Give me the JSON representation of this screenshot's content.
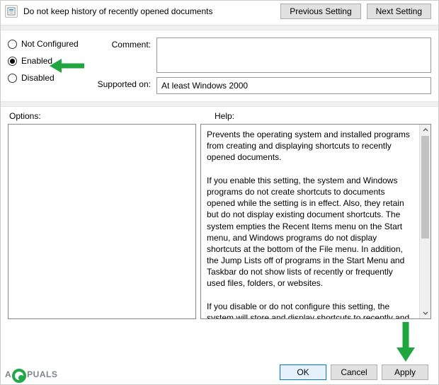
{
  "header": {
    "title": "Do not keep history of recently opened documents",
    "prev": "Previous Setting",
    "next": "Next Setting",
    "icon": "policy-icon"
  },
  "radios": {
    "not_configured": "Not Configured",
    "enabled": "Enabled",
    "disabled": "Disabled",
    "selected": "enabled"
  },
  "fields": {
    "comment_label": "Comment:",
    "comment_value": "",
    "supported_label": "Supported on:",
    "supported_value": "At least Windows 2000"
  },
  "sections": {
    "options": "Options:",
    "help": "Help:"
  },
  "help_text": "Prevents the operating system and installed programs from creating and displaying shortcuts to recently opened documents.\n\nIf you enable this setting, the system and Windows programs do not create shortcuts to documents opened while the setting is in effect. Also, they retain but do not display existing document shortcuts. The system empties the Recent Items menu on the Start menu, and Windows programs do not display shortcuts at the bottom of the File menu. In addition, the Jump Lists off of programs in the Start Menu and Taskbar do not show lists of recently or frequently used files, folders, or websites.\n\nIf you disable or do not configure this setting, the system will store and display shortcuts to recently and frequently used files, folders, and websites.\n\nNote: The system saves document shortcuts in the user profile in the System-drive\\Users\\User-name\\Recent folder.\n\nAlso, see the \"Remove Recent Items menu from Start Menu\" and \"Clear history of recently opened documents on exit\" policies in",
  "buttons": {
    "ok": "OK",
    "cancel": "Cancel",
    "apply": "Apply"
  },
  "watermark": {
    "pre": "A",
    "post": "PUALS"
  },
  "annotation": {
    "arrow_color": "#1fa63f"
  }
}
